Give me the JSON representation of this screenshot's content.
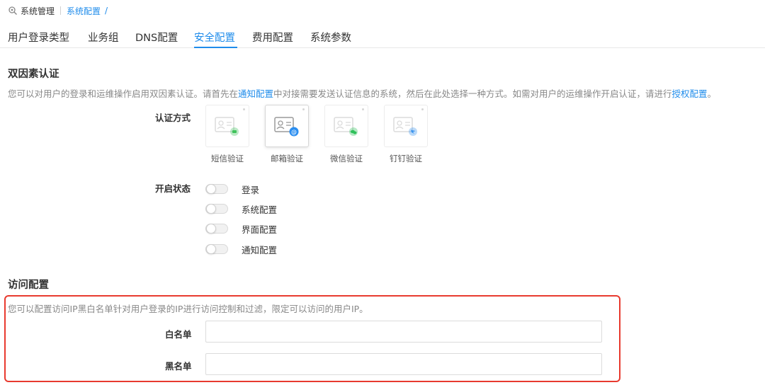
{
  "breadcrumb": {
    "icon": "search-cog-icon",
    "root": "系统管理",
    "current": "系统配置",
    "separator": "/"
  },
  "tabs": [
    {
      "label": "用户登录类型",
      "active": false
    },
    {
      "label": "业务组",
      "active": false
    },
    {
      "label": "DNS配置",
      "active": false
    },
    {
      "label": "安全配置",
      "active": true
    },
    {
      "label": "费用配置",
      "active": false
    },
    {
      "label": "系统参数",
      "active": false
    }
  ],
  "two_factor": {
    "title": "双因素认证",
    "desc_part1": "您可以对用户的登录和运维操作启用双因素认证。请首先在",
    "desc_link1": "通知配置",
    "desc_part2": "中对接需要发送认证信息的系统，然后在此处选择一种方式。如需对用户的运维操作开启认证，请进行",
    "desc_link2": "授权配置",
    "desc_part3": "。",
    "method_label": "认证方式",
    "methods": [
      {
        "label": "短信验证",
        "icon": "sms-card-icon",
        "badge_color": "#3fc35b",
        "active": false
      },
      {
        "label": "邮箱验证",
        "icon": "email-card-icon",
        "badge_color": "#2b8ef0",
        "active": true
      },
      {
        "label": "微信验证",
        "icon": "wechat-card-icon",
        "badge_color": "#2fc05a",
        "active": false
      },
      {
        "label": "钉钉验证",
        "icon": "dingtalk-card-icon",
        "badge_color": "#3b95ef",
        "active": false
      }
    ],
    "status_label": "开启状态",
    "toggles": [
      {
        "label": "登录",
        "on": false
      },
      {
        "label": "系统配置",
        "on": false
      },
      {
        "label": "界面配置",
        "on": false
      },
      {
        "label": "通知配置",
        "on": false
      }
    ]
  },
  "access": {
    "title": "访问配置",
    "desc": "您可以配置访问IP黑白名单针对用户登录的IP进行访问控制和过滤，限定可以访问的用户IP。",
    "whitelist_label": "白名单",
    "whitelist_value": "",
    "blacklist_label": "黑名单",
    "blacklist_value": ""
  },
  "colors": {
    "accent": "#1f8ceb",
    "highlight_frame": "#e83a2f"
  }
}
